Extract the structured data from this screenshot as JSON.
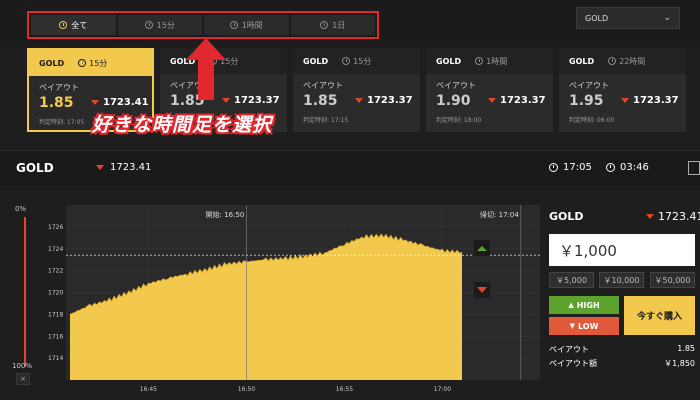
{
  "period_tabs": [
    {
      "label": "全て",
      "active": true
    },
    {
      "label": "15分",
      "active": false
    },
    {
      "label": "1時間",
      "active": false
    },
    {
      "label": "1日",
      "active": false
    }
  ],
  "asset_select": {
    "value": "GOLD"
  },
  "cards": [
    {
      "asset": "GOLD",
      "period": "15分",
      "payout_label": "ペイアウト",
      "payout": "1.85",
      "price": "1723.41",
      "close": "判定時刻: 17:05",
      "active": true
    },
    {
      "asset": "GOLD",
      "period": "15分",
      "payout_label": "ペイアウト",
      "payout": "1.85",
      "price": "1723.37",
      "close": "判定時刻: 17:",
      "active": false
    },
    {
      "asset": "GOLD",
      "period": "15分",
      "payout_label": "ペイアウト",
      "payout": "1.85",
      "price": "1723.37",
      "close": "判定時刻: 17:15",
      "active": false
    },
    {
      "asset": "GOLD",
      "period": "1時間",
      "payout_label": "ペイアウト",
      "payout": "1.90",
      "price": "1723.37",
      "close": "判定時刻: 18:00",
      "active": false
    },
    {
      "asset": "GOLD",
      "period": "22時間",
      "payout_label": "ペイアウト",
      "payout": "1.95",
      "price": "1723.37",
      "close": "判定時刻: 06:00",
      "active": false
    }
  ],
  "annotation": {
    "text": "好きな時間足を選択"
  },
  "asset_header": {
    "name": "GOLD",
    "price": "1723.41",
    "time_close": "17:05",
    "time_left": "03:46"
  },
  "slider": {
    "top_label": "0%",
    "bottom_label": "100%",
    "close_label": "×"
  },
  "chart_data": {
    "type": "area",
    "x": [
      "16:41",
      "16:42",
      "16:43",
      "16:44",
      "16:45",
      "16:46",
      "16:47",
      "16:48",
      "16:49",
      "16:50",
      "16:51",
      "16:52",
      "16:53",
      "16:54",
      "16:55",
      "16:56",
      "16:57",
      "16:58",
      "16:59",
      "17:00",
      "17:01"
    ],
    "values": [
      1718.0,
      1718.8,
      1719.3,
      1720.0,
      1720.8,
      1721.3,
      1721.7,
      1722.1,
      1722.6,
      1722.8,
      1723.0,
      1723.1,
      1723.3,
      1723.6,
      1724.4,
      1725.1,
      1725.2,
      1724.8,
      1724.3,
      1723.8,
      1723.7
    ],
    "ylim": [
      1712,
      1728
    ],
    "yticks": [
      1714,
      1716,
      1718,
      1720,
      1722,
      1724,
      1726
    ],
    "xticks": [
      "16:45",
      "16:50",
      "16:55",
      "17:00"
    ],
    "start_label": "開始: 16:50",
    "end_label": "帰切: 17:04",
    "current_price": 1723.41,
    "fill_color": "#f2c94c"
  },
  "trade_panel": {
    "asset": "GOLD",
    "price": "1723.41",
    "amount": "￥1,000",
    "quick_amounts": [
      "￥5,000",
      "￥10,000",
      "￥50,000"
    ],
    "high_label": "HIGH",
    "low_label": "LOW",
    "buy_label": "今すぐ購入",
    "payout_label": "ペイアウト",
    "payout_value": "1.85",
    "payout_amount_label": "ペイアウト額",
    "payout_amount_value": "￥1,850"
  },
  "colors": {
    "accent": "#f2c94c",
    "high": "#5fa32f",
    "low": "#e05a3a",
    "highlight": "#e0282e"
  }
}
